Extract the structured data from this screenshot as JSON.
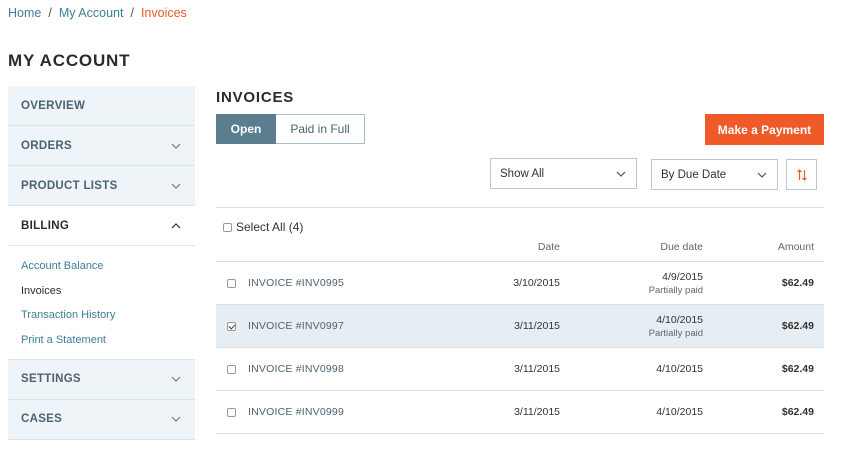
{
  "breadcrumb": {
    "home": "Home",
    "account": "My Account",
    "current": "Invoices",
    "separator": "/"
  },
  "page_title": "MY ACCOUNT",
  "sidebar": {
    "sections": [
      {
        "label": "OVERVIEW"
      },
      {
        "label": "ORDERS"
      },
      {
        "label": "PRODUCT LISTS"
      },
      {
        "label": "BILLING"
      },
      {
        "label": "SETTINGS"
      },
      {
        "label": "CASES"
      }
    ],
    "billing_items": [
      {
        "label": "Account Balance"
      },
      {
        "label": "Invoices"
      },
      {
        "label": "Transaction History"
      },
      {
        "label": "Print a Statement"
      }
    ]
  },
  "main": {
    "title": "INVOICES",
    "tabs": [
      {
        "label": "Open"
      },
      {
        "label": "Paid in Full"
      }
    ],
    "pay_button": "Make a Payment",
    "filter": {
      "value": "Show All"
    },
    "sort": {
      "value": "By Due Date"
    },
    "select_all": "Select All (4)",
    "columns": {
      "date": "Date",
      "due": "Due date",
      "amount": "Amount"
    },
    "invoices": [
      {
        "name": "INVOICE #INV0995",
        "date": "3/10/2015",
        "due": "4/9/2015",
        "status": "Partially paid",
        "amount": "$62.49",
        "checked": false
      },
      {
        "name": "INVOICE #INV0997",
        "date": "3/11/2015",
        "due": "4/10/2015",
        "status": "Partially paid",
        "amount": "$62.49",
        "checked": true
      },
      {
        "name": "INVOICE #INV0998",
        "date": "3/11/2015",
        "due": "4/10/2015",
        "status": "",
        "amount": "$62.49",
        "checked": false
      },
      {
        "name": "INVOICE #INV0999",
        "date": "3/11/2015",
        "due": "4/10/2015",
        "status": "",
        "amount": "$62.49",
        "checked": false
      }
    ]
  },
  "colors": {
    "accent": "#f05a28",
    "link": "#3d7f99",
    "tab_active": "#5a7e90",
    "row_selected": "#e6eef3",
    "sidebar_bg": "#eef4f8"
  },
  "icons": {
    "chevron_down": "chevron-down-icon",
    "chevron_up": "chevron-up-icon",
    "sort": "sort-arrows-icon"
  }
}
